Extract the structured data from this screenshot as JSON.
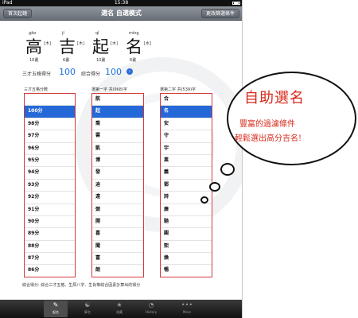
{
  "statusbar": {
    "carrier": "iPad",
    "time": "15:38"
  },
  "navbar": {
    "left_button": "首次起鏈",
    "title": "選名 自選模式",
    "right_button": "更改篩選條件"
  },
  "name_chars": [
    {
      "pinyin": "gāo",
      "char": "高",
      "element": "[木]",
      "strokes": "10畫"
    },
    {
      "pinyin": "jí",
      "char": "吉",
      "element": "[木]",
      "strokes": "6畫"
    },
    {
      "pinyin": "qǐ",
      "char": "起",
      "element": "[木]",
      "strokes": "10畫"
    },
    {
      "pinyin": "míng",
      "char": "名",
      "element": "[水]",
      "strokes": "6畫"
    }
  ],
  "scores": {
    "label1": "三才五格得分",
    "value1": "100",
    "label2": "綜合得分",
    "value2": "100",
    "info_icon": "info-icon"
  },
  "columns": {
    "col1_header": "三才五格分數",
    "col2_header": "選第一字 共(968)字",
    "col3_header": "選第二字 共(539)字"
  },
  "list1": [
    "",
    "100分",
    "98分",
    "97分",
    "96分",
    "95分",
    "94分",
    "93分",
    "92分",
    "91分",
    "90分",
    "89分",
    "88分",
    "87分",
    "86分"
  ],
  "list2": [
    "航",
    "起",
    "喬",
    "雲",
    "凱",
    "博",
    "發",
    "迪",
    "遠",
    "弼",
    "開",
    "喜",
    "聞",
    "富",
    "朗"
  ],
  "list3": [
    "合",
    "名",
    "安",
    "守",
    "宇",
    "業",
    "義",
    "鄧",
    "詩",
    "廉",
    "馳",
    "圓",
    "熙",
    "煥",
    "暢"
  ],
  "footnote": "綜合得分: 綜合三才五格、生辰八字、生肖等綜合因素計算出的得分",
  "tabs": [
    {
      "label": "起名",
      "icon": "name-icon"
    },
    {
      "label": "算名",
      "icon": "yinyang-icon"
    },
    {
      "label": "收藏",
      "icon": "star-icon"
    },
    {
      "label": "History",
      "icon": "clock-icon"
    },
    {
      "label": "More",
      "icon": "more-icon"
    }
  ],
  "bubble": {
    "headline": "自助選名",
    "line1": "豐富的過濾條件",
    "line2": "輕鬆選出高分吉名!"
  },
  "colors": {
    "accent": "#2568d8",
    "bubble_text": "#d8281b",
    "list_border": "#d23b3b"
  }
}
